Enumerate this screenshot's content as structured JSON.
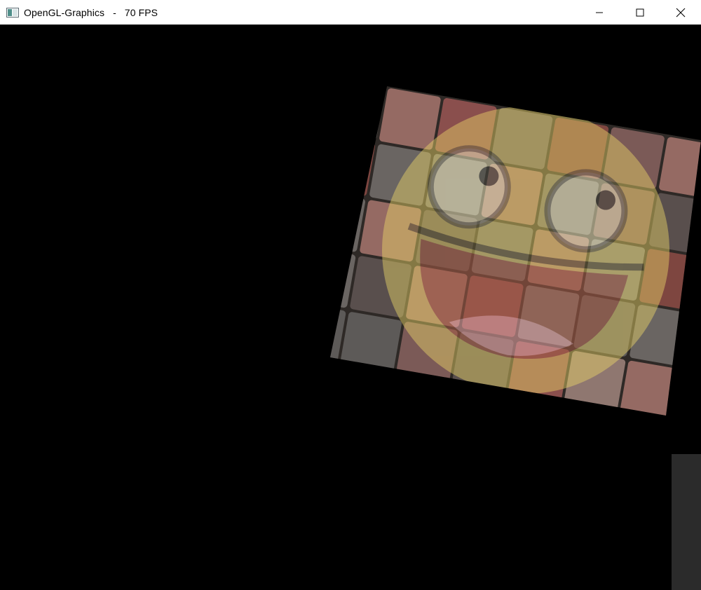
{
  "window": {
    "title": "OpenGL-Graphics   -   70 FPS",
    "app_icon": "window-app-icon",
    "controls": {
      "minimize_icon": "minimize-icon",
      "maximize_icon": "maximize-icon",
      "close_icon": "close-icon"
    }
  },
  "scene": {
    "background_color": "#000000",
    "textured_quad": {
      "base_texture": "brick-paver-tiles",
      "overlay_texture": "smiley-face",
      "overlay_color": "#e8d468"
    }
  }
}
